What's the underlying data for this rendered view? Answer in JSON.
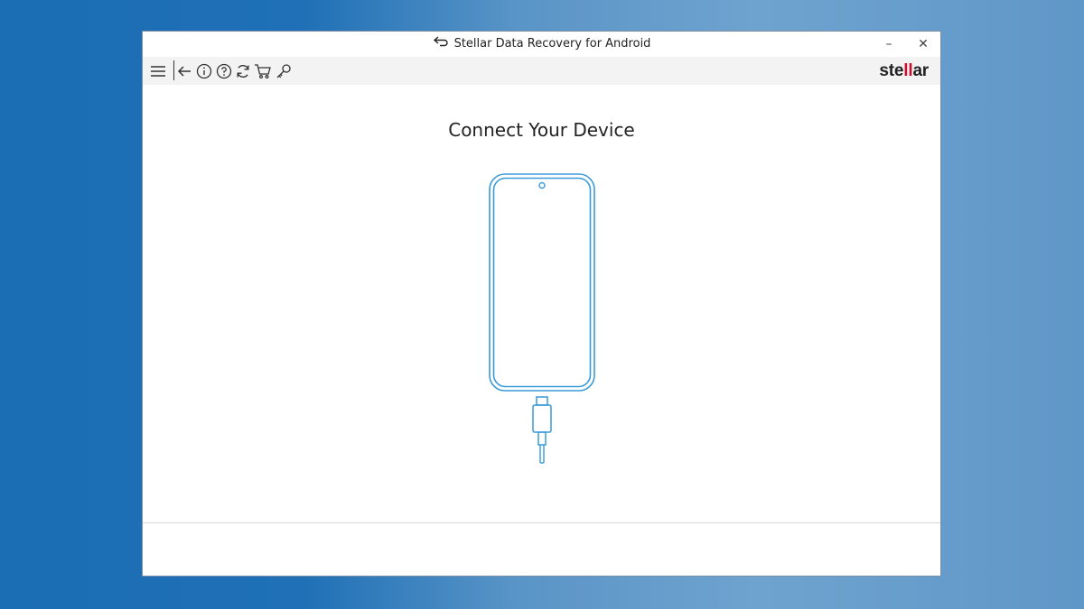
{
  "window": {
    "title": "Stellar Data Recovery for Android",
    "minimize_label": "–",
    "close_label": "✕"
  },
  "toolbar": {
    "icons": [
      "menu-icon",
      "back-arrow-icon",
      "info-icon",
      "help-icon",
      "refresh-icon",
      "cart-icon",
      "key-icon"
    ]
  },
  "brand": {
    "prefix": "ste",
    "highlight": "ll",
    "suffix": "ar",
    "highlight_color": "#c8102e"
  },
  "main": {
    "heading": "Connect Your Device",
    "illustration": "phone-with-usb-cable-icon",
    "accent_color": "#3a9ad9"
  }
}
